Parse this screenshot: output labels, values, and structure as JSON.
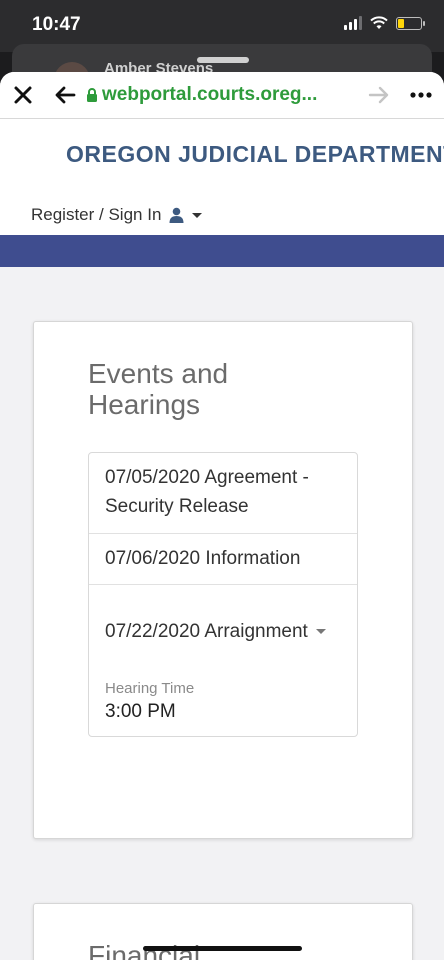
{
  "status_bar": {
    "time": "10:47",
    "battery_color": "#ffd60a"
  },
  "behind": {
    "name": "Amber Stevens"
  },
  "browser": {
    "url": "webportal.courts.oreg...",
    "close_icon": "close-icon",
    "back_icon": "back-arrow-icon",
    "forward_icon": "forward-arrow-icon",
    "more_icon": "more-icon",
    "url_color": "#2e9b3b"
  },
  "site": {
    "title": "OREGON JUDICIAL DEPARTMENT",
    "signin_label": "Register / Sign In",
    "band_color": "#3f4d8f"
  },
  "events": {
    "title": "Events and Hearings",
    "items": [
      {
        "label": "07/05/2020 Agreement - Security Release"
      },
      {
        "label": "07/06/2020 Information"
      },
      {
        "label": "07/22/2020 Arraignment",
        "detail_label": "Hearing Time",
        "detail_value": "3:00 PM"
      }
    ]
  },
  "financial": {
    "title": "Financial"
  }
}
